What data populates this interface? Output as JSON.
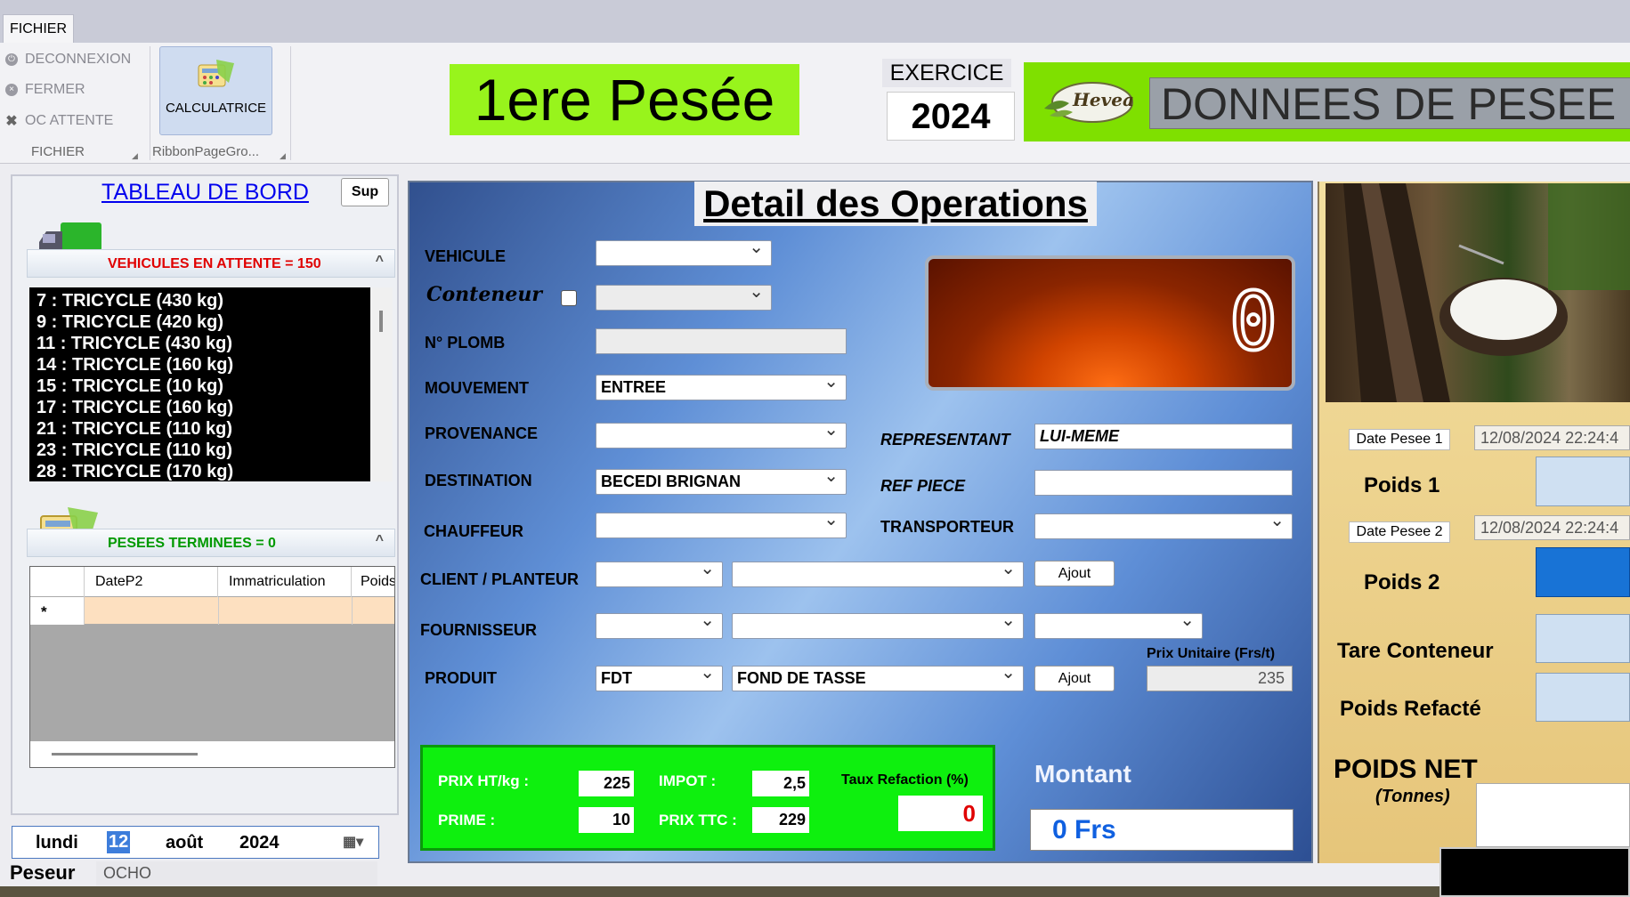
{
  "ribbon": {
    "tab": "FICHIER",
    "menu": [
      {
        "icon": "logout-icon",
        "label": "DECONNEXION"
      },
      {
        "icon": "close-circle-icon",
        "label": "FERMER"
      },
      {
        "icon": "x-icon",
        "label": "OC ATTENTE"
      }
    ],
    "group1": "FICHIER",
    "calc_label": "CALCULATRICE",
    "group2": "RibbonPageGro..."
  },
  "header": {
    "pesee": "1ere Pesée",
    "exercice_label": "EXERCICE",
    "exercice": "2024",
    "logo": "Hevea",
    "donnees": "DONNEES DE PESEE"
  },
  "left": {
    "tableau": "TABLEAU DE BORD",
    "sup": "Sup",
    "vehicules_header": "VEHICULES EN ATTENTE = 150",
    "vehicules": [
      "7 : TRICYCLE (430 kg)",
      "9 : TRICYCLE (420 kg)",
      "11 : TRICYCLE (430 kg)",
      "14 : TRICYCLE (160 kg)",
      "15 : TRICYCLE (10 kg)",
      "17 : TRICYCLE (160 kg)",
      "21 : TRICYCLE (110 kg)",
      "23 : TRICYCLE (110 kg)",
      "28 : TRICYCLE (170 kg)"
    ],
    "pesees_header": "PESEES TERMINEES = 0",
    "grid_cols": [
      "DateP2",
      "Immatriculation",
      "Poids"
    ],
    "grid_newrow": "*",
    "cal": {
      "day": "lundi",
      "date": "12",
      "month": "août",
      "year": "2024"
    },
    "peseur_label": "Peseur",
    "peseur": "OCHO"
  },
  "form": {
    "title": "Detail des Operations",
    "vehicule": "VEHICULE",
    "conteneur": "Conteneur",
    "plomb": "N° PLOMB",
    "mouvement": "MOUVEMENT",
    "mouvement_val": "ENTREE",
    "provenance": "PROVENANCE",
    "destination": "DESTINATION",
    "destination_val": "BECEDI BRIGNAN",
    "chauffeur": "CHAUFFEUR",
    "client": "CLIENT / PLANTEUR",
    "fournisseur": "FOURNISSEUR",
    "produit": "PRODUIT",
    "produit_code": "FDT",
    "produit_val": "FOND DE TASSE",
    "representant": "REPRESENTANT",
    "representant_val": "LUI-MEME",
    "ref_piece": "REF PIECE",
    "transporteur": "TRANSPORTEUR",
    "ajout": "Ajout",
    "prix_unit_label": "Prix Unitaire (Frs/t)",
    "prix_unit": "235",
    "display": "0"
  },
  "prices": {
    "ht_label": "PRIX HT/kg :",
    "ht": "225",
    "impot_label": "IMPOT :",
    "impot": "2,5",
    "refaction_label": "Taux Refaction (%)",
    "refaction": "0",
    "prime_label": "PRIME :",
    "prime": "10",
    "ttc_label": "PRIX TTC :",
    "ttc": "229",
    "montant_label": "Montant",
    "montant": "0 Frs"
  },
  "right": {
    "date1_label": "Date Pesee 1",
    "date1": "12/08/2024 22:24:4",
    "poids1": "Poids 1",
    "date2_label": "Date Pesee 2",
    "date2": "12/08/2024 22:24:4",
    "poids2": "Poids 2",
    "tare": "Tare Conteneur",
    "refacte": "Poids Refacté",
    "net": "POIDS NET",
    "tonnes": "(Tonnes)"
  }
}
